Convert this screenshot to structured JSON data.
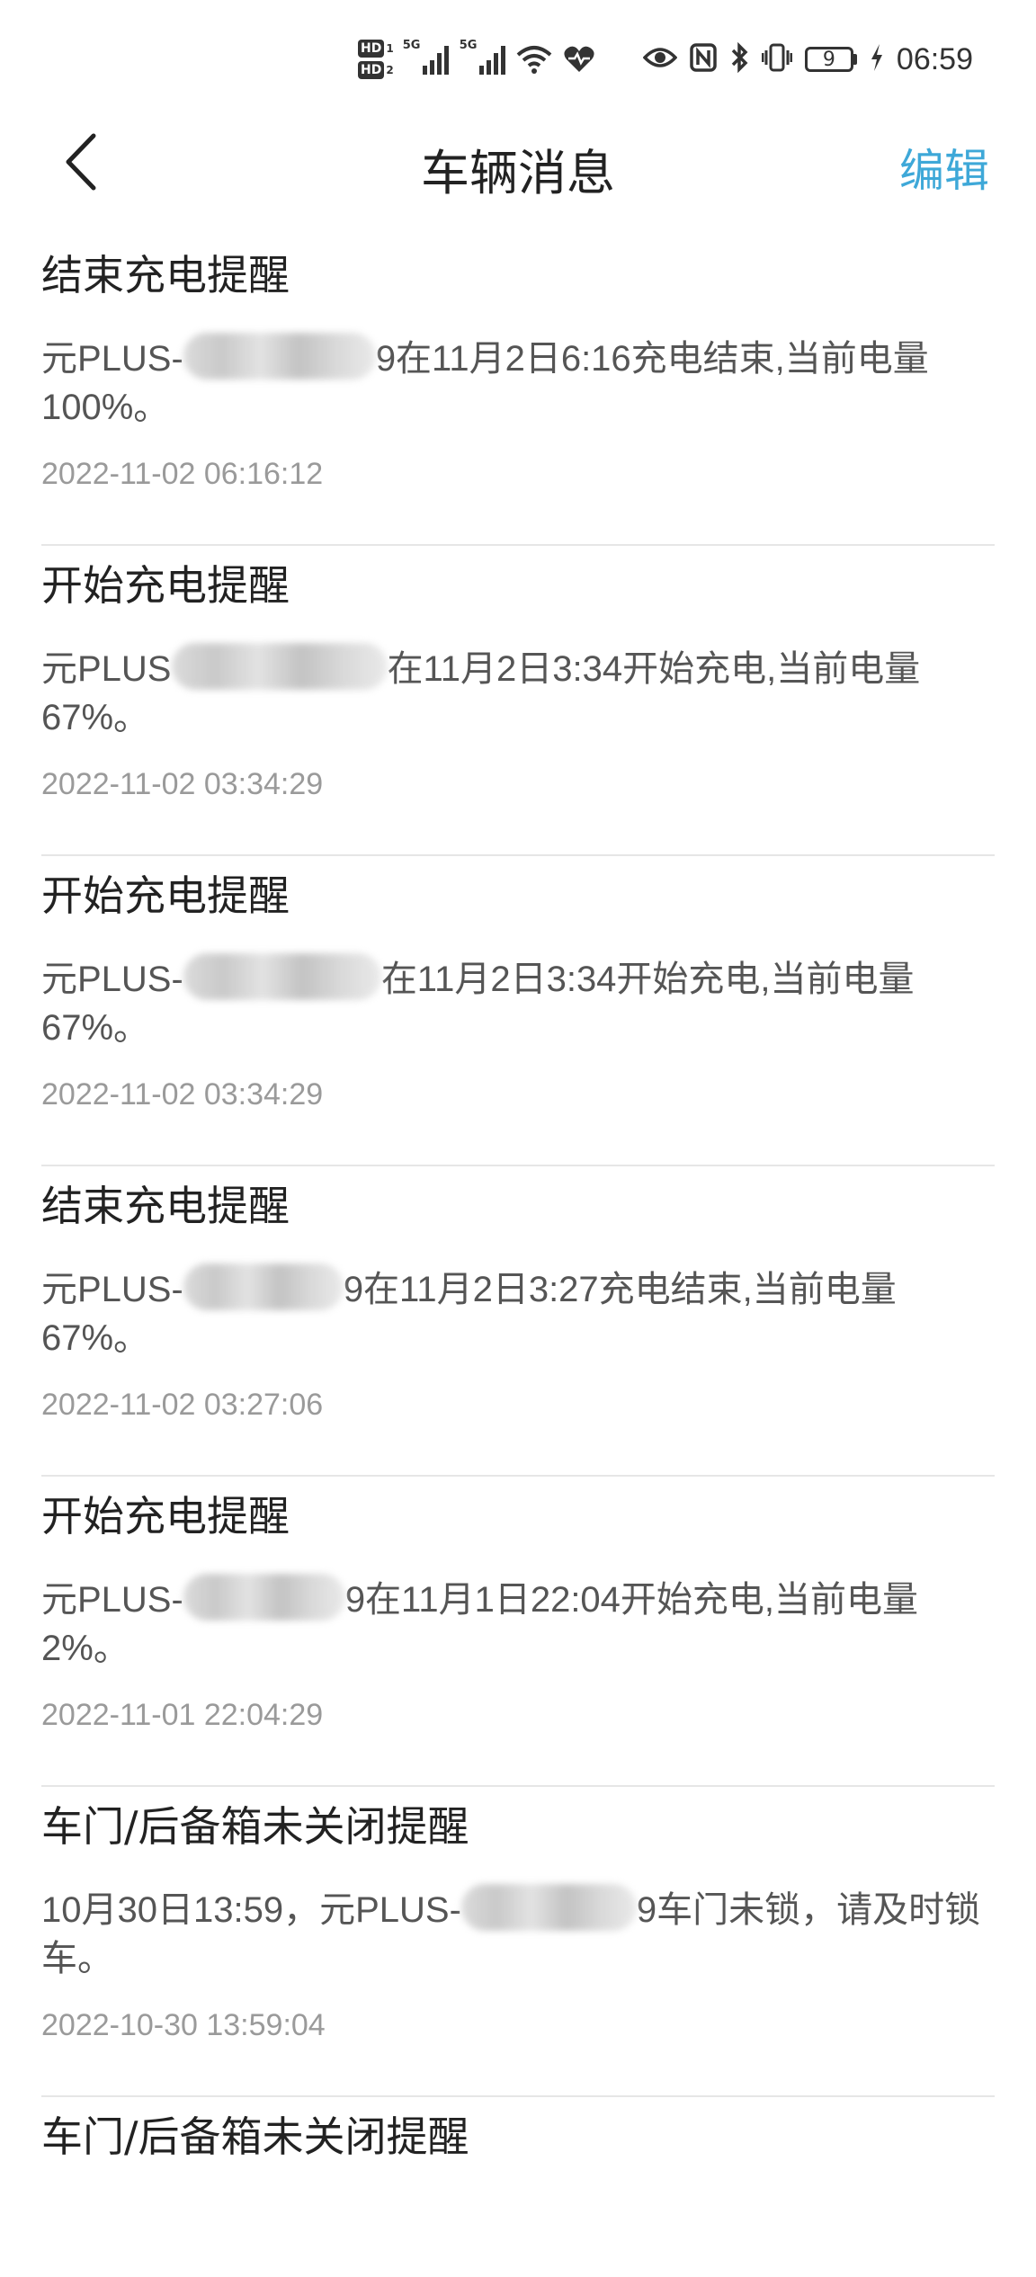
{
  "status_bar": {
    "hd1": "HD",
    "hd1_num": "1",
    "hd2": "HD",
    "hd2_num": "2",
    "sig1_label": "5G",
    "sig2_label": "5G",
    "battery_level": "9",
    "time": "06:59"
  },
  "header": {
    "title": "车辆消息",
    "edit_label": "编辑"
  },
  "messages": [
    {
      "title": "结束充电提醒",
      "body_prefix": "元PLUS-",
      "body_suffix": "9在11月2日6:16充电结束,当前电量100%。",
      "time": "2022-11-02 06:16:12"
    },
    {
      "title": "开始充电提醒",
      "body_prefix": "元PLUS",
      "body_suffix": "在11月2日3:34开始充电,当前电量67%。",
      "time": "2022-11-02 03:34:29"
    },
    {
      "title": "开始充电提醒",
      "body_prefix": "元PLUS-",
      "body_suffix": "在11月2日3:34开始充电,当前电量67%。",
      "time": "2022-11-02 03:34:29"
    },
    {
      "title": "结束充电提醒",
      "body_prefix": "元PLUS-",
      "body_suffix": "9在11月2日3:27充电结束,当前电量67%。",
      "time": "2022-11-02 03:27:06"
    },
    {
      "title": "开始充电提醒",
      "body_prefix": "元PLUS-",
      "body_suffix": "9在11月1日22:04开始充电,当前电量2%。",
      "time": "2022-11-01 22:04:29"
    },
    {
      "title": "车门/后备箱未关闭提醒",
      "body_prefix": "10月30日13:59，元PLUS-",
      "body_suffix": "9车门未锁，请及时锁车。",
      "time": "2022-10-30 13:59:04"
    },
    {
      "title": "车门/后备箱未关闭提醒"
    }
  ]
}
